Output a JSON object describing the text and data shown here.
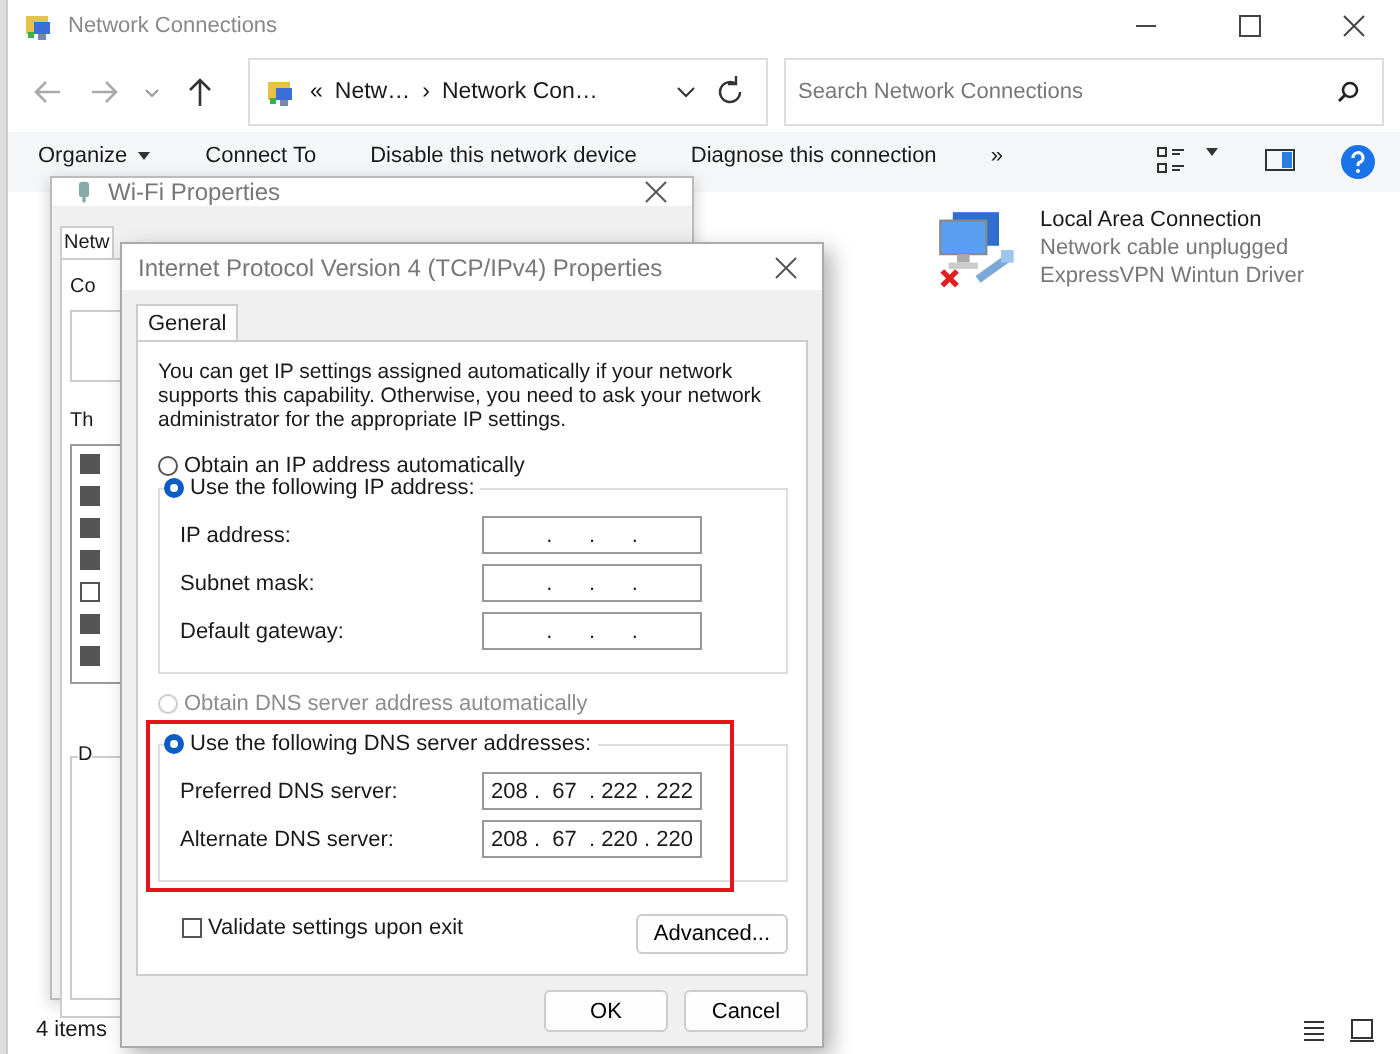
{
  "explorer": {
    "title": "Network Connections",
    "breadcrumb": [
      "«",
      "Netw…",
      "›",
      "Network Con…"
    ],
    "search": {
      "placeholder": "Search Network Connections"
    },
    "commands": [
      {
        "label": "Organize",
        "kind": "menu"
      },
      {
        "label": "Connect To",
        "kind": "plain"
      },
      {
        "label": "Disable this network device",
        "kind": "plain"
      },
      {
        "label": "Diagnose this connection",
        "kind": "plain"
      },
      {
        "label": "»",
        "kind": "plain"
      }
    ],
    "connections": [
      {
        "name": "Local Area Connection",
        "status": "Network cable unplugged",
        "device": "ExpressVPN Wintun Driver",
        "disconnected": true
      }
    ],
    "status_bar": {
      "count": "4 items"
    }
  },
  "wifi_dialog": {
    "title": "Wi-Fi Properties",
    "tab": "Netw",
    "connect_label": "Co",
    "items_label": "Th",
    "group_label": "D",
    "items": [
      {
        "checked": true
      },
      {
        "checked": true
      },
      {
        "checked": true
      },
      {
        "checked": true
      },
      {
        "checked": false
      },
      {
        "checked": true
      },
      {
        "checked": true
      }
    ]
  },
  "ipv4_dialog": {
    "title": "Internet Protocol Version 4 (TCP/IPv4) Properties",
    "tabs": [
      {
        "label": "General",
        "selected": true
      }
    ],
    "intro": "You can get IP settings assigned automatically if your network supports this capability. Otherwise, you need to ask your network administrator for the appropriate IP settings.",
    "ip_mode": [
      {
        "label": "Obtain an IP address automatically",
        "selected": false,
        "disabled": false
      },
      {
        "label": "Use the following IP address:",
        "selected": true,
        "disabled": false
      }
    ],
    "ip_fields": [
      {
        "label": "IP address:",
        "value": ".      .      ."
      },
      {
        "label": "Subnet mask:",
        "value": ".      .      ."
      },
      {
        "label": "Default gateway:",
        "value": ".      .      ."
      }
    ],
    "dns_mode": [
      {
        "label": "Obtain DNS server address automatically",
        "selected": false,
        "disabled": true
      },
      {
        "label": "Use the following DNS server addresses:",
        "selected": true,
        "disabled": false
      }
    ],
    "dns_fields": [
      {
        "label": "Preferred DNS server:",
        "value": "208 .  67  . 222 . 222"
      },
      {
        "label": "Alternate DNS server:",
        "value": "208 .  67  . 220 . 220"
      }
    ],
    "highlighted": true,
    "validate": {
      "label": "Validate settings upon exit",
      "checked": false
    },
    "advanced": "Advanced...",
    "buttons": [
      "OK",
      "Cancel"
    ]
  }
}
